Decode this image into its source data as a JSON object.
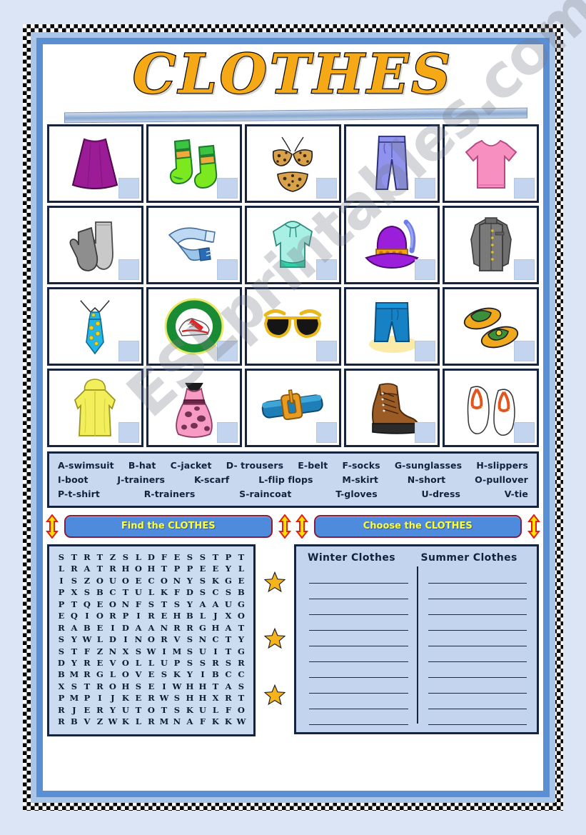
{
  "title": "CLOTHES",
  "watermark": "ESLprintables.com",
  "pictures": [
    {
      "item": "skirt",
      "icon": "skirt-icon"
    },
    {
      "item": "socks",
      "icon": "socks-icon"
    },
    {
      "item": "swimsuit",
      "icon": "swimsuit-icon"
    },
    {
      "item": "trousers",
      "icon": "trousers-icon"
    },
    {
      "item": "t-shirt",
      "icon": "t-shirt-icon"
    },
    {
      "item": "gloves",
      "icon": "gloves-icon"
    },
    {
      "item": "scarf",
      "icon": "scarf-icon"
    },
    {
      "item": "pullover",
      "icon": "pullover-icon"
    },
    {
      "item": "hat",
      "icon": "hat-icon"
    },
    {
      "item": "jacket",
      "icon": "jacket-icon"
    },
    {
      "item": "tie",
      "icon": "tie-icon"
    },
    {
      "item": "trainers",
      "icon": "trainers-icon"
    },
    {
      "item": "sunglasses",
      "icon": "sunglasses-icon"
    },
    {
      "item": "short",
      "icon": "shorts-icon"
    },
    {
      "item": "slippers",
      "icon": "slippers-icon"
    },
    {
      "item": "raincoat",
      "icon": "raincoat-icon"
    },
    {
      "item": "dress",
      "icon": "dress-icon"
    },
    {
      "item": "belt",
      "icon": "belt-icon"
    },
    {
      "item": "boot",
      "icon": "boot-icon"
    },
    {
      "item": "flip flops",
      "icon": "flip-flops-icon"
    }
  ],
  "wordbank": {
    "rows": [
      [
        "A-swimsuit",
        "B-hat",
        "C-jacket",
        "D- trousers",
        "E-belt",
        "F-socks",
        "G-sunglasses",
        "H-slippers"
      ],
      [
        "I-boot",
        "J-trainers",
        "K-scarf",
        "L-flip flops",
        "M-skirt",
        "N-short",
        "O-pullover"
      ],
      [
        "P-t-shirt",
        "R-trainers",
        "S-raincoat",
        "T-gloves",
        "U-dress",
        "V-tie"
      ]
    ]
  },
  "tasks": {
    "find_label": "Find the CLOTHES",
    "choose_label": "Choose the CLOTHES"
  },
  "wordsearch": {
    "rows": [
      [
        "S",
        "T",
        "R",
        "T",
        "Z",
        "S",
        "L",
        "D",
        "F",
        "E",
        "S",
        "S",
        "T",
        "P",
        "T"
      ],
      [
        "L",
        "R",
        "A",
        "T",
        "R",
        "H",
        "O",
        "H",
        "T",
        "P",
        "P",
        "E",
        "E",
        "Y",
        "L"
      ],
      [
        "I",
        "S",
        "Z",
        "O",
        "U",
        "O",
        "E",
        "C",
        "O",
        "N",
        "Y",
        "S",
        "K",
        "G",
        "E"
      ],
      [
        "P",
        "X",
        "S",
        "B",
        "C",
        "T",
        "U",
        "L",
        "K",
        "F",
        "D",
        "S",
        "C",
        "S",
        "B"
      ],
      [
        "P",
        "T",
        "Q",
        "E",
        "O",
        "N",
        "F",
        "S",
        "T",
        "S",
        "Y",
        "A",
        "A",
        "U",
        "G"
      ],
      [
        "E",
        "Q",
        "I",
        "O",
        "R",
        "P",
        "I",
        "R",
        "E",
        "H",
        "B",
        "L",
        "J",
        "X",
        "O"
      ],
      [
        "R",
        "A",
        "B",
        "E",
        "I",
        "D",
        "A",
        "A",
        "N",
        "R",
        "R",
        "G",
        "H",
        "A",
        "T"
      ],
      [
        "S",
        "Y",
        "W",
        "L",
        "D",
        "I",
        "N",
        "O",
        "R",
        "V",
        "S",
        "N",
        "C",
        "T",
        "Y"
      ],
      [
        "S",
        "T",
        "F",
        "Z",
        "N",
        "X",
        "S",
        "W",
        "I",
        "M",
        "S",
        "U",
        "I",
        "T",
        "G"
      ],
      [
        "D",
        "Y",
        "R",
        "E",
        "V",
        "O",
        "L",
        "L",
        "U",
        "P",
        "S",
        "S",
        "R",
        "S",
        "R"
      ],
      [
        "B",
        "M",
        "R",
        "G",
        "L",
        "O",
        "V",
        "E",
        "S",
        "K",
        "Y",
        "I",
        "B",
        "C",
        "C"
      ],
      [
        "X",
        "S",
        "T",
        "R",
        "O",
        "H",
        "S",
        "E",
        "I",
        "W",
        "H",
        "H",
        "T",
        "A",
        "S"
      ],
      [
        "P",
        "M",
        "P",
        "I",
        "J",
        "K",
        "E",
        "R",
        "W",
        "S",
        "H",
        "H",
        "X",
        "R",
        "T"
      ],
      [
        "R",
        "J",
        "E",
        "R",
        "Y",
        "U",
        "T",
        "O",
        "T",
        "S",
        "K",
        "U",
        "L",
        "F",
        "O"
      ],
      [
        "R",
        "B",
        "V",
        "Z",
        "W",
        "K",
        "L",
        "R",
        "M",
        "N",
        "A",
        "F",
        "K",
        "K",
        "W"
      ]
    ]
  },
  "categories": {
    "winter_label": "Winter Clothes",
    "summer_label": "Summer Clothes",
    "line_count": 10
  },
  "colors": {
    "title": "#f5a916",
    "frame_blue": "#5b8fd4",
    "panel_blue": "#c3d5ee",
    "border_navy": "#16233f",
    "button_blue": "#4e8bdd",
    "button_text": "#ffff3a",
    "star": "#f5b41c"
  }
}
